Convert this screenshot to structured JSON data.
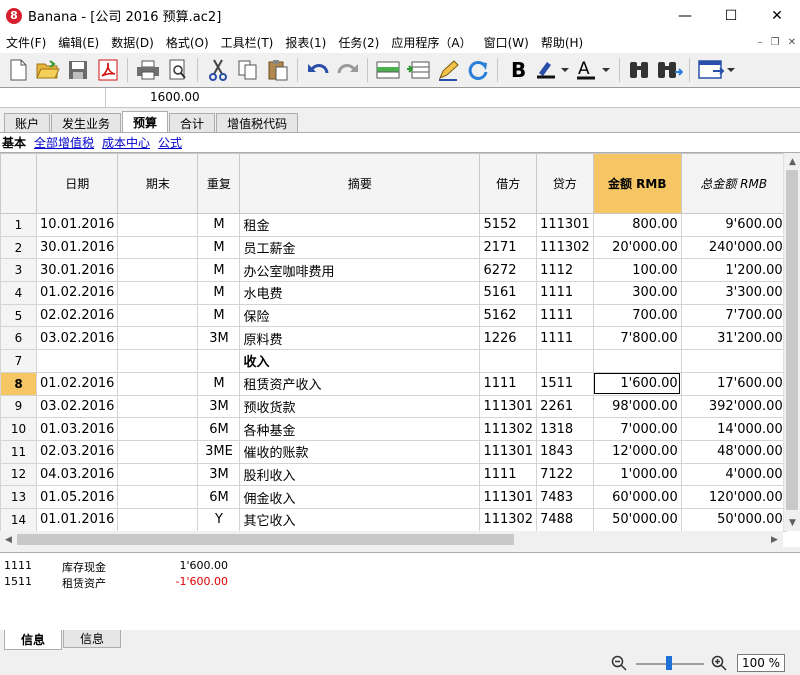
{
  "window": {
    "title": "Banana - [公司 2016 预算.ac2]",
    "logo": "8"
  },
  "menu": [
    "文件(F)",
    "编辑(E)",
    "数据(D)",
    "格式(O)",
    "工具栏(T)",
    "报表(1)",
    "任务(2)",
    "应用程序（A）",
    "窗口(W)",
    "帮助(H)"
  ],
  "toolbar_icons": [
    "new-file-icon",
    "open-folder-icon",
    "save-icon",
    "pdf-icon",
    "print-icon",
    "print-preview-icon",
    "cut-icon",
    "copy-icon",
    "paste-icon",
    "undo-icon",
    "redo-icon",
    "add-rows-icon",
    "insert-rows-icon",
    "edit-icon",
    "refresh-icon",
    "bold-icon",
    "highlight-icon",
    "font-color-icon",
    "find-icon",
    "find-next-icon",
    "window-icon"
  ],
  "formula_bar": {
    "value": "1600.00"
  },
  "tabs": [
    "账户",
    "发生业务",
    "预算",
    "合计",
    "增值税代码"
  ],
  "active_tab": 2,
  "views": [
    "基本",
    "全部增值税",
    "成本中心",
    "公式"
  ],
  "columns": [
    "",
    "日期",
    "期末",
    "重复",
    "摘要",
    "借方",
    "贷方",
    "金额 RMB",
    "总金额 RMB"
  ],
  "rows": [
    {
      "n": "1",
      "date": "10.01.2016",
      "end": "",
      "rep": "M",
      "desc": "租金",
      "debit": "5152",
      "credit": "111301",
      "amount": "800.00",
      "total": "9'600.00"
    },
    {
      "n": "2",
      "date": "30.01.2016",
      "end": "",
      "rep": "M",
      "desc": "员工薪金",
      "debit": "2171",
      "credit": "111302",
      "amount": "20'000.00",
      "total": "240'000.00"
    },
    {
      "n": "3",
      "date": "30.01.2016",
      "end": "",
      "rep": "M",
      "desc": "办公室咖啡费用",
      "debit": "6272",
      "credit": "1112",
      "amount": "100.00",
      "total": "1'200.00"
    },
    {
      "n": "4",
      "date": "01.02.2016",
      "end": "",
      "rep": "M",
      "desc": "水电费",
      "debit": "5161",
      "credit": "1111",
      "amount": "300.00",
      "total": "3'300.00"
    },
    {
      "n": "5",
      "date": "02.02.2016",
      "end": "",
      "rep": "M",
      "desc": "保险",
      "debit": "5162",
      "credit": "1111",
      "amount": "700.00",
      "total": "7'700.00"
    },
    {
      "n": "6",
      "date": "03.02.2016",
      "end": "",
      "rep": "3M",
      "desc": "原料费",
      "debit": "1226",
      "credit": "1111",
      "amount": "7'800.00",
      "total": "31'200.00"
    },
    {
      "n": "7",
      "date": "",
      "end": "",
      "rep": "",
      "desc": "收入",
      "debit": "",
      "credit": "",
      "amount": "",
      "total": ""
    },
    {
      "n": "8",
      "date": "01.02.2016",
      "end": "",
      "rep": "M",
      "desc": "租赁资产收入",
      "debit": "1111",
      "credit": "1511",
      "amount": "1'600.00",
      "total": "17'600.00"
    },
    {
      "n": "9",
      "date": "03.02.2016",
      "end": "",
      "rep": "3M",
      "desc": "预收货款",
      "debit": "111301",
      "credit": "2261",
      "amount": "98'000.00",
      "total": "392'000.00"
    },
    {
      "n": "10",
      "date": "01.03.2016",
      "end": "",
      "rep": "6M",
      "desc": "各种基金",
      "debit": "111302",
      "credit": "1318",
      "amount": "7'000.00",
      "total": "14'000.00"
    },
    {
      "n": "11",
      "date": "02.03.2016",
      "end": "",
      "rep": "3ME",
      "desc": "催收的账款",
      "debit": "111301",
      "credit": "1843",
      "amount": "12'000.00",
      "total": "48'000.00"
    },
    {
      "n": "12",
      "date": "04.03.2016",
      "end": "",
      "rep": "3M",
      "desc": "股利收入",
      "debit": "1111",
      "credit": "7122",
      "amount": "1'000.00",
      "total": "4'000.00"
    },
    {
      "n": "13",
      "date": "01.05.2016",
      "end": "",
      "rep": "6M",
      "desc": "佣金收入",
      "debit": "111301",
      "credit": "7483",
      "amount": "60'000.00",
      "total": "120'000.00"
    },
    {
      "n": "14",
      "date": "01.01.2016",
      "end": "",
      "rep": "Y",
      "desc": "其它收入",
      "debit": "111302",
      "credit": "7488",
      "amount": "50'000.00",
      "total": "50'000.00"
    }
  ],
  "info": [
    {
      "acc": "1111",
      "desc": "库存现金",
      "amount": "1'600.00"
    },
    {
      "acc": "1511",
      "desc": "租赁资产",
      "amount": "-1'600.00"
    }
  ],
  "bottom_tabs": [
    "信息",
    "信息"
  ],
  "zoom": "100 %"
}
